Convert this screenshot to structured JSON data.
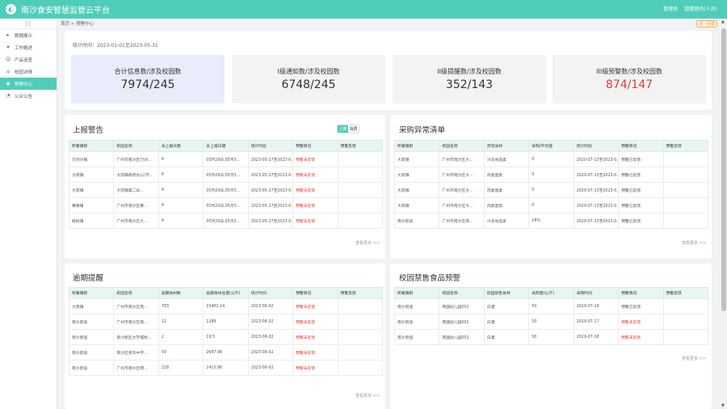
{
  "app": {
    "title": "南沙食安智慧监管云平台",
    "user": "管理员",
    "logout": "超管理员(人员)"
  },
  "sidebar": {
    "items": [
      {
        "label": "数据展示",
        "icon": "chevron-right-icon"
      },
      {
        "label": "工作概述",
        "icon": "chevron-down-icon"
      },
      {
        "label": "产品追查",
        "icon": "person-icon"
      },
      {
        "label": "校园详情",
        "icon": "building-icon"
      },
      {
        "label": "预警中心",
        "icon": "alert-icon"
      },
      {
        "label": "公众公告",
        "icon": "bell-icon"
      }
    ]
  },
  "breadcrumb": "首页 > 预警中心",
  "tab_button": "返一后端",
  "stats": {
    "range": "统计时间：2023-01-01至2023-05-31",
    "cards": [
      {
        "label": "合计信息数/涉及校园数",
        "value": "7974/245"
      },
      {
        "label": "I级通知数/涉及校园数",
        "value": "6748/245"
      },
      {
        "label": "II级提醒数/涉及校园数",
        "value": "352/143"
      },
      {
        "label": "III级预警数/涉及校园数",
        "value": "874/147"
      }
    ]
  },
  "report": {
    "title": "上报警告",
    "toggle_on": "上报",
    "toggle_off": "消费",
    "more": "查看更多 >>",
    "headers": [
      "所属镇街",
      "校园名称",
      "未上报天数",
      "未上报日期",
      "统计时段",
      "预警情况",
      "预警反馈"
    ],
    "rows": [
      [
        "万顷沙镇",
        "广州市南沙区万顷...",
        "4",
        "05月29日,05月3...",
        "2023-05-27至2023-0...",
        "预警未反馈",
        ""
      ],
      [
        "大岗镇",
        "大岗镇政府办公(学...",
        "4",
        "05月29日,05月3...",
        "2023-05-27至2023-0...",
        "预警未反馈",
        ""
      ],
      [
        "大岗镇",
        "大岗镇第二幼...",
        "4",
        "05月29日,05月3...",
        "2023-05-27至2023-0...",
        "预警未反馈",
        ""
      ],
      [
        "黄阁镇",
        "广州市南沙区黄...",
        "4",
        "05月29日,05月3...",
        "2023-05-27至2023-0...",
        "预警未反馈",
        ""
      ],
      [
        "榄核镇",
        "广州市南沙区大...",
        "4",
        "05月29日,05月3...",
        "2023-05-27至2023-0...",
        "预警未反馈",
        ""
      ]
    ]
  },
  "purchase": {
    "title": "采购异常清单",
    "more": "查看更多 >>",
    "headers": [
      "所属镇街",
      "校园名称",
      "异常食材",
      "采购/平均值",
      "统计时段",
      "预警情况",
      "预警反馈"
    ],
    "rows": [
      [
        "大岗镇",
        "广州市南沙区大...",
        "冷冻食品类",
        "0",
        "2020-07-13至2023-0...",
        "预警已反馈",
        ""
      ],
      [
        "大岗镇",
        "广州市南沙区大...",
        "肉类蛋类",
        "0",
        "2020-07-13至2023-0...",
        "预警已反馈",
        ""
      ],
      [
        "大岗镇",
        "广州市南沙区大...",
        "肉类蛋类",
        "0",
        "2020-07-13至2023-0...",
        "预警已反馈",
        ""
      ],
      [
        "大岗镇",
        "广州市南沙区大...",
        "肉类蛋类",
        "0",
        "2020-07-13至2023-0...",
        "预警已反馈",
        ""
      ],
      [
        "南沙街道",
        "广州市南沙区南...",
        "冷冻食品类",
        "28%",
        "2020-07-13至2023-0...",
        "预警已反馈",
        ""
      ]
    ]
  },
  "expiry": {
    "title": "逾期提醒",
    "more": "查看更多 >>",
    "headers": [
      "所属镇街",
      "校园名称",
      "逾期食材数",
      "逾期食材总量(公斤)",
      "统计时间",
      "预警情况",
      "预警反馈"
    ],
    "rows": [
      [
        "大岗镇",
        "广州市南沙区南...",
        "783",
        "15462.14",
        "2023-06-02",
        "预警未反馈",
        ""
      ],
      [
        "南沙街道",
        "广州市南沙区南...",
        "12",
        "1289",
        "2023-06-02",
        "预警未反馈",
        ""
      ],
      [
        "南沙街道",
        "南沙新区大学城附...",
        "2",
        "19.5",
        "2023-06-02",
        "预警未反馈",
        ""
      ],
      [
        "南沙街道",
        "南沙区英东中学...",
        "59",
        "2647.96",
        "2023-06-02",
        "预警未反馈",
        ""
      ],
      [
        "南沙街道",
        "广州市南沙区明...",
        "228",
        "2415.86",
        "2023-06-02",
        "预警未反馈",
        ""
      ]
    ]
  },
  "banned": {
    "title": "校园禁售食品预警",
    "more": "查看更多 >>",
    "headers": [
      "所属镇街",
      "校园名称",
      "校园禁售食材",
      "采购量(公斤)",
      "采购时间",
      "预警情况",
      "预警反馈"
    ],
    "rows": [
      [
        "南沙街道",
        "英国幼儿园001",
        "白酒",
        "50",
        "2019-07-19",
        "预警已反馈",
        ""
      ],
      [
        "南沙街道",
        "英国幼儿园001",
        "白酒",
        "50",
        "2019-07-17",
        "预警未反馈",
        ""
      ],
      [
        "南沙街道",
        "英国幼儿园001",
        "白酒",
        "50",
        "2019-07-18",
        "预警未反馈",
        ""
      ]
    ]
  }
}
